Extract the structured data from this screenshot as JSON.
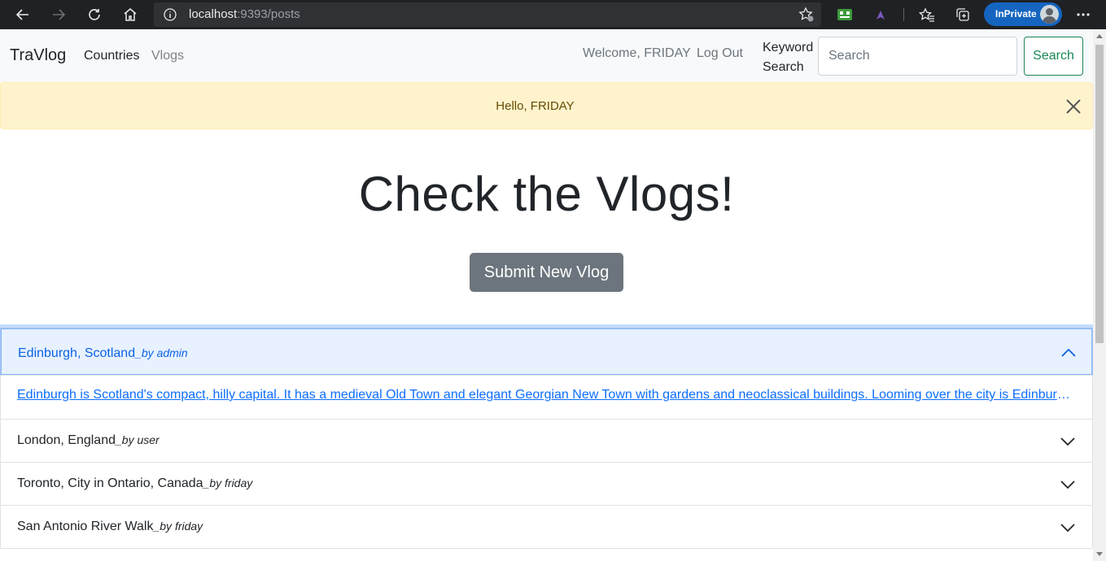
{
  "browser": {
    "url_host": "localhost",
    "url_rest": ":9393/posts",
    "inprivate_label": "InPrivate",
    "icons": [
      "back-icon",
      "forward-icon",
      "refresh-icon",
      "home-icon",
      "info-icon",
      "favorite-add-icon",
      "extension-icon",
      "extension-icon",
      "favorites-icon",
      "collections-icon",
      "profile-avatar-icon",
      "more-icon"
    ]
  },
  "navbar": {
    "brand": "TraVlog",
    "links": {
      "countries": "Countries",
      "vlogs": "Vlogs"
    },
    "welcome": "Welcome, FRIDAY",
    "logout": "Log Out",
    "keyword_label": "Keyword Search",
    "search_placeholder": "Search",
    "search_button": "Search"
  },
  "alert": {
    "text": "Hello, FRIDAY"
  },
  "hero": {
    "title": "Check the Vlogs!",
    "submit_button": "Submit New Vlog"
  },
  "posts": [
    {
      "title": "Edinburgh, Scotland",
      "author": "_by admin",
      "expanded": true,
      "body": "Edinburgh is Scotland's compact, hilly capital. It has a medieval Old Town and elegant Georgian New Town with gardens and neoclassical buildings. Looming over the city is Edinburgh..."
    },
    {
      "title": "London, England",
      "author": "_by user",
      "expanded": false
    },
    {
      "title": "Toronto, City in Ontario, Canada",
      "author": "_by friday",
      "expanded": false
    },
    {
      "title": "San Antonio River Walk",
      "author": "_by friday",
      "expanded": false
    }
  ],
  "colors": {
    "alert_bg": "#fff3cd",
    "alert_text": "#664d03",
    "accordion_open_bg": "#e7f1ff",
    "accordion_open_text": "#0c63e4",
    "success": "#198754",
    "secondary": "#6c757d",
    "link": "#0d6efd"
  }
}
